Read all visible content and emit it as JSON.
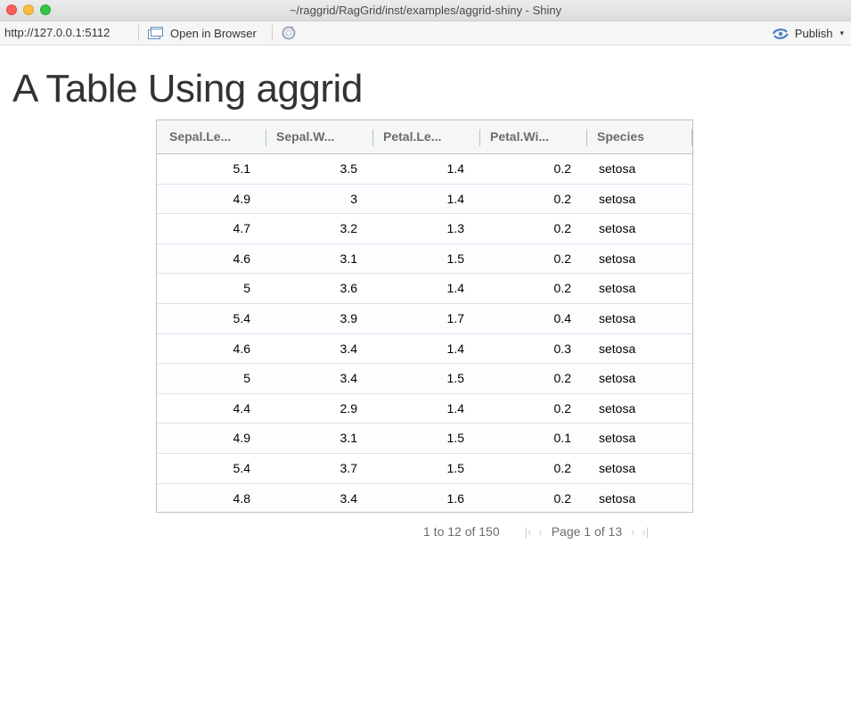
{
  "window": {
    "title": "~/raggrid/RagGrid/inst/examples/aggrid-shiny - Shiny"
  },
  "toolbar": {
    "url": "http://127.0.0.1:5112",
    "open_in_browser": "Open in Browser",
    "publish": "Publish",
    "caret": "▾"
  },
  "page": {
    "title": "A Table Using aggrid"
  },
  "grid": {
    "columns": [
      "Sepal.Le...",
      "Sepal.W...",
      "Petal.Le...",
      "Petal.Wi...",
      "Species"
    ],
    "rows": [
      [
        "5.1",
        "3.5",
        "1.4",
        "0.2",
        "setosa"
      ],
      [
        "4.9",
        "3",
        "1.4",
        "0.2",
        "setosa"
      ],
      [
        "4.7",
        "3.2",
        "1.3",
        "0.2",
        "setosa"
      ],
      [
        "4.6",
        "3.1",
        "1.5",
        "0.2",
        "setosa"
      ],
      [
        "5",
        "3.6",
        "1.4",
        "0.2",
        "setosa"
      ],
      [
        "5.4",
        "3.9",
        "1.7",
        "0.4",
        "setosa"
      ],
      [
        "4.6",
        "3.4",
        "1.4",
        "0.3",
        "setosa"
      ],
      [
        "5",
        "3.4",
        "1.5",
        "0.2",
        "setosa"
      ],
      [
        "4.4",
        "2.9",
        "1.4",
        "0.2",
        "setosa"
      ],
      [
        "4.9",
        "3.1",
        "1.5",
        "0.1",
        "setosa"
      ],
      [
        "5.4",
        "3.7",
        "1.5",
        "0.2",
        "setosa"
      ],
      [
        "4.8",
        "3.4",
        "1.6",
        "0.2",
        "setosa"
      ]
    ]
  },
  "pagination": {
    "summary": "1 to 12 of 150",
    "page_label": "Page 1 of 13",
    "first": "|‹",
    "prev": "‹",
    "next": "›",
    "last": "›|"
  },
  "icons": {
    "open_in_browser": "browser-window-icon",
    "refresh": "refresh-icon",
    "publish": "publish-icon"
  },
  "colors": {
    "close": "#fc605c",
    "minimize": "#fdbc40",
    "maximize": "#34c84a",
    "publish_icon": "#4a7fc1"
  }
}
